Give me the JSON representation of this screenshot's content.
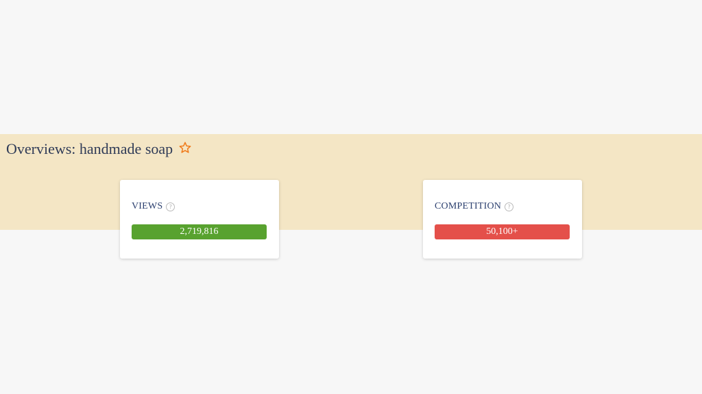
{
  "header": {
    "title": "Overviews: handmade soap",
    "favorite_icon": "star-outline-icon"
  },
  "cards": {
    "views": {
      "label": "VIEWS",
      "help_icon": "question-circle-icon",
      "help_glyph": "?",
      "value": "2,719,816",
      "color": "#58a22f"
    },
    "competition": {
      "label": "COMPETITION",
      "help_icon": "question-circle-icon",
      "help_glyph": "?",
      "value": "50,100+",
      "color": "#e4504a"
    }
  },
  "colors": {
    "banner": "#f4e6c5",
    "accent_star": "#f07a1a"
  }
}
